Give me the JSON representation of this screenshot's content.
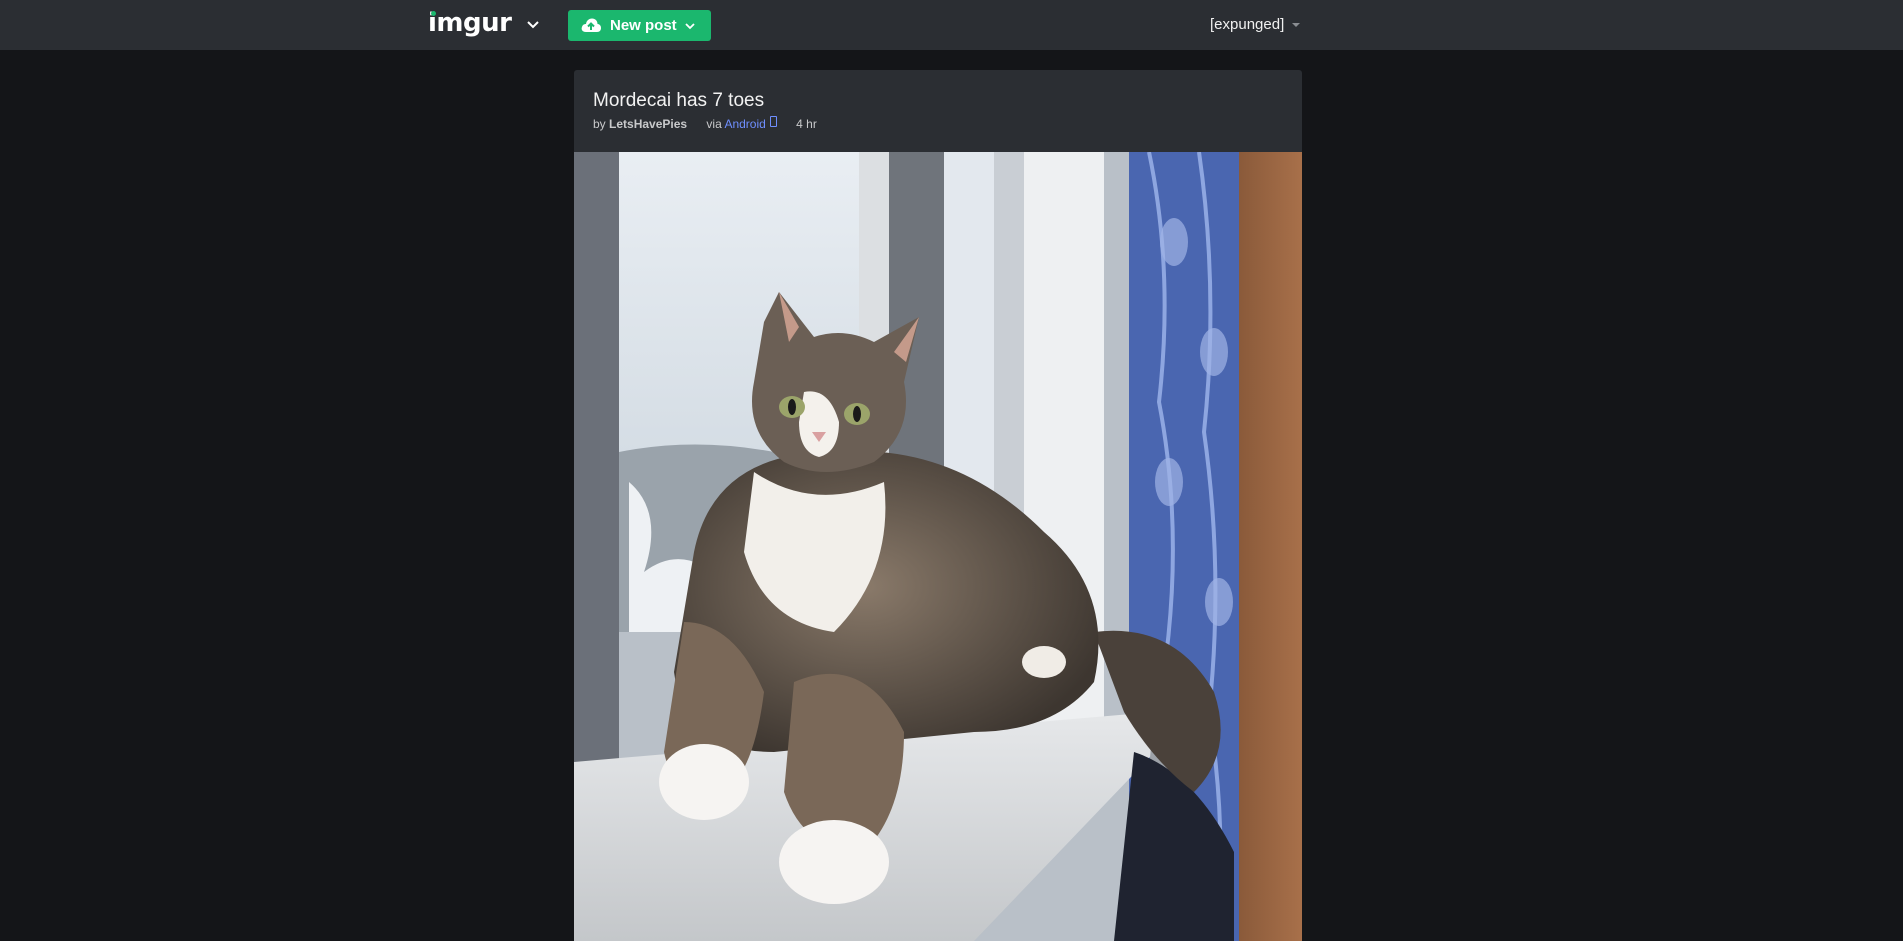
{
  "header": {
    "logo_text": "imgur",
    "new_post_label": "New post",
    "username": "[expunged]",
    "brand_color": "#1bb76e"
  },
  "post": {
    "title": "Mordecai has 7 toes",
    "by_prefix": "by",
    "author": "LetsHavePies",
    "via_prefix": "via",
    "platform": "Android",
    "time_ago": "4 hr"
  },
  "icons": {
    "logo_menu": "chevron-down-icon",
    "upload": "cloud-upload-icon",
    "new_post_menu": "chevron-down-icon",
    "user_menu": "caret-down-icon",
    "platform": "phone-icon"
  }
}
